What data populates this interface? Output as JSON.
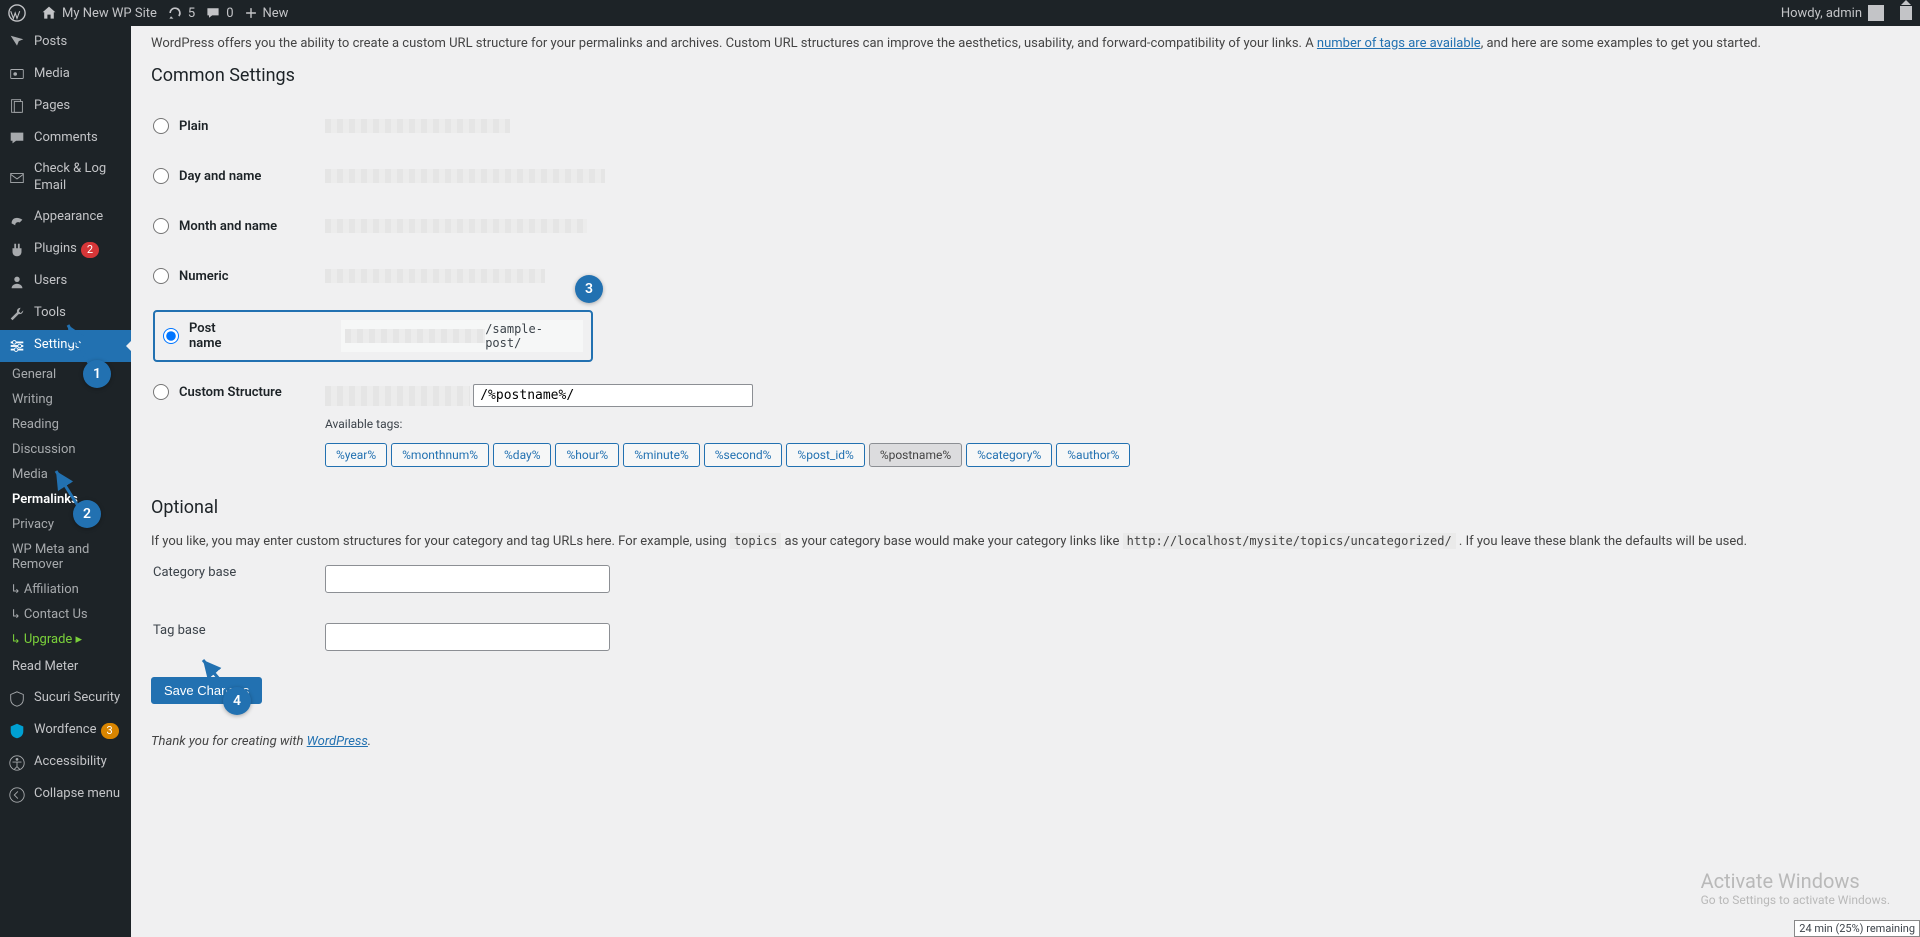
{
  "adminbar": {
    "site_name": "My New WP Site",
    "refresh_count": "5",
    "comments_count": "0",
    "new_label": "New",
    "howdy": "Howdy, admin"
  },
  "menu": {
    "posts": "Posts",
    "media": "Media",
    "pages": "Pages",
    "comments": "Comments",
    "checklog": "Check & Log Email",
    "appearance": "Appearance",
    "plugins": "Plugins",
    "plugins_badge": "2",
    "users": "Users",
    "tools": "Tools",
    "settings": "Settings",
    "sub": {
      "general": "General",
      "writing": "Writing",
      "reading": "Reading",
      "discussion": "Discussion",
      "media": "Media",
      "permalinks": "Permalinks",
      "privacy": "Privacy",
      "wpmeta": "WP Meta and Remover",
      "affiliation": "Affiliation",
      "contact": "Contact Us",
      "upgrade": "Upgrade"
    },
    "readmeter": "Read Meter",
    "sucuri": "Sucuri Security",
    "wordfence": "Wordfence",
    "wordfence_badge": "3",
    "accessibility": "Accessibility",
    "collapse": "Collapse menu"
  },
  "content": {
    "intro_pre": "WordPress offers you the ability to create a custom URL structure for your permalinks and archives. Custom URL structures can improve the aesthetics, usability, and forward-compatibility of your links. A ",
    "intro_link": "number of tags are available",
    "intro_post": ", and here are some examples to get you started.",
    "common_heading": "Common Settings",
    "options": {
      "plain": "Plain",
      "dayname": "Day and name",
      "monthname": "Month and name",
      "numeric": "Numeric",
      "postname": "Post name",
      "postname_example": "/sample-post/",
      "custom": "Custom Structure",
      "custom_value": "/%postname%/",
      "available_tags_label": "Available tags:"
    },
    "tags": [
      "%year%",
      "%monthnum%",
      "%day%",
      "%hour%",
      "%minute%",
      "%second%",
      "%post_id%",
      "%postname%",
      "%category%",
      "%author%"
    ],
    "active_tag_index": 7,
    "optional_heading": "Optional",
    "optional_desc_pre": "If you like, you may enter custom structures for your category and tag URLs here. For example, using ",
    "optional_code1": "topics",
    "optional_desc_mid": " as your category base would make your category links like ",
    "optional_code2": "http://localhost/mysite/topics/uncategorized/",
    "optional_desc_post": " . If you leave these blank the defaults will be used.",
    "category_base": "Category base",
    "tag_base": "Tag base",
    "save": "Save Changes",
    "thanks_pre": "Thank you for creating with ",
    "thanks_link": "WordPress",
    "thanks_post": "."
  },
  "annotations": {
    "c1": "1",
    "c2": "2",
    "c3": "3",
    "c4": "4"
  },
  "watermark": {
    "title": "Activate Windows",
    "sub": "Go to Settings to activate Windows."
  },
  "battery": "24 min (25%) remaining"
}
